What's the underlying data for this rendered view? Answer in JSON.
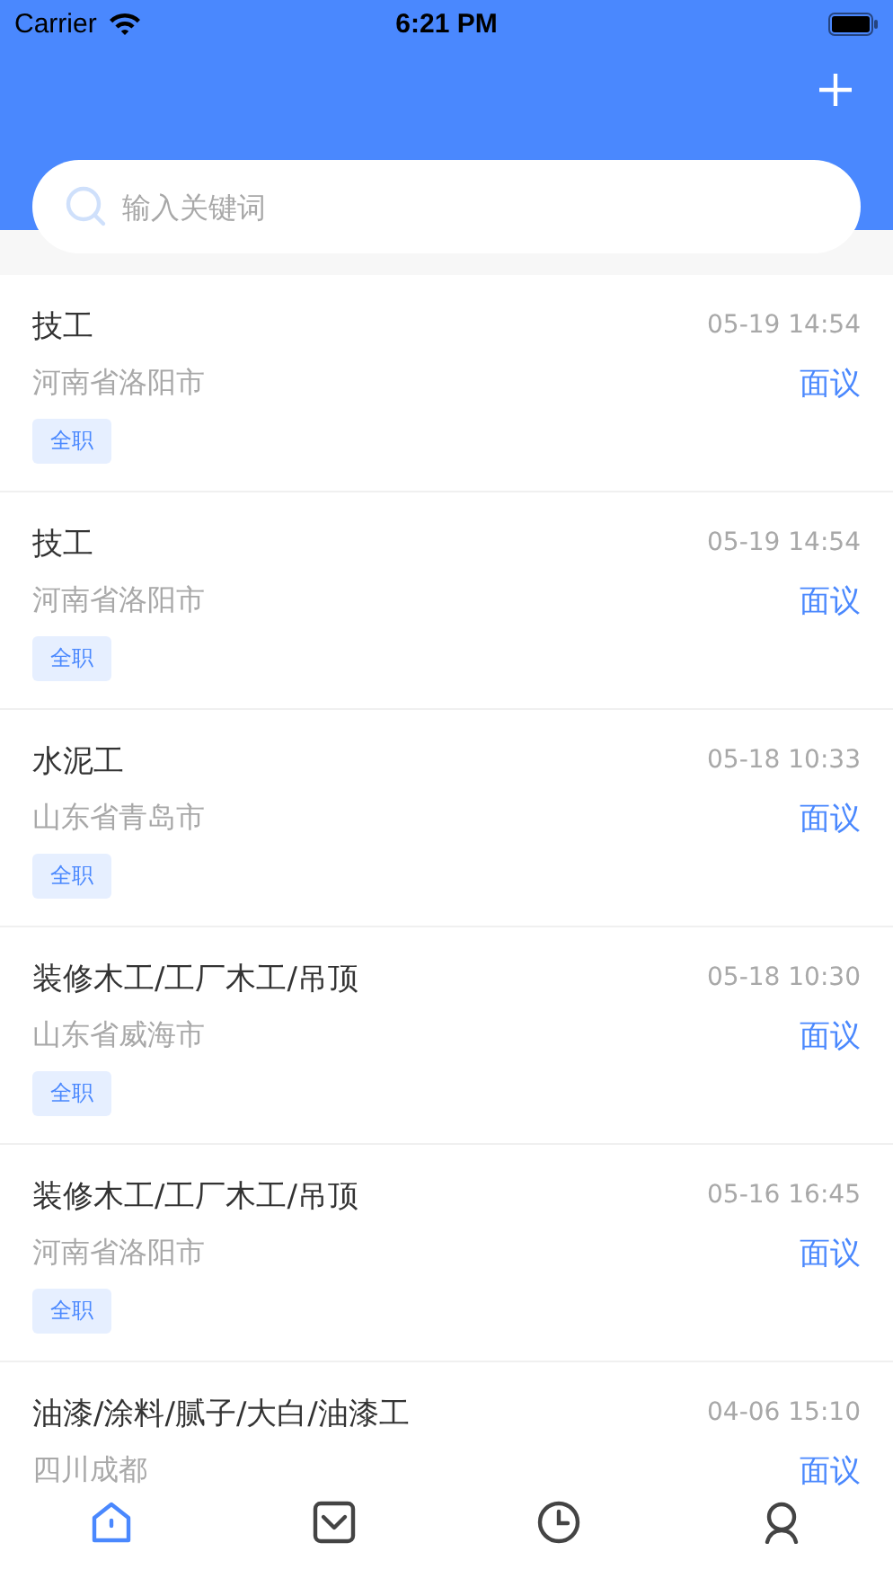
{
  "status_bar": {
    "carrier": "Carrier",
    "time": "6:21 PM"
  },
  "search": {
    "placeholder": "输入关键词"
  },
  "jobs": [
    {
      "title": "技工",
      "time": "05-19 14:54",
      "location": "河南省洛阳市",
      "salary": "面议",
      "tag": "全职"
    },
    {
      "title": "技工",
      "time": "05-19 14:54",
      "location": "河南省洛阳市",
      "salary": "面议",
      "tag": "全职"
    },
    {
      "title": "水泥工",
      "time": "05-18 10:33",
      "location": "山东省青岛市",
      "salary": "面议",
      "tag": "全职"
    },
    {
      "title": "装修木工/工厂木工/吊顶",
      "time": "05-18 10:30",
      "location": "山东省威海市",
      "salary": "面议",
      "tag": "全职"
    },
    {
      "title": "装修木工/工厂木工/吊顶",
      "time": "05-16 16:45",
      "location": "河南省洛阳市",
      "salary": "面议",
      "tag": "全职"
    },
    {
      "title": "油漆/涂料/腻子/大白/油漆工",
      "time": "04-06 15:10",
      "location": "四川成都",
      "salary": "面议"
    }
  ],
  "tab_bar": [
    {
      "kind": "home",
      "selected": true
    },
    {
      "kind": "message",
      "selected": false
    },
    {
      "kind": "history",
      "selected": false
    },
    {
      "kind": "profile",
      "selected": false
    }
  ]
}
